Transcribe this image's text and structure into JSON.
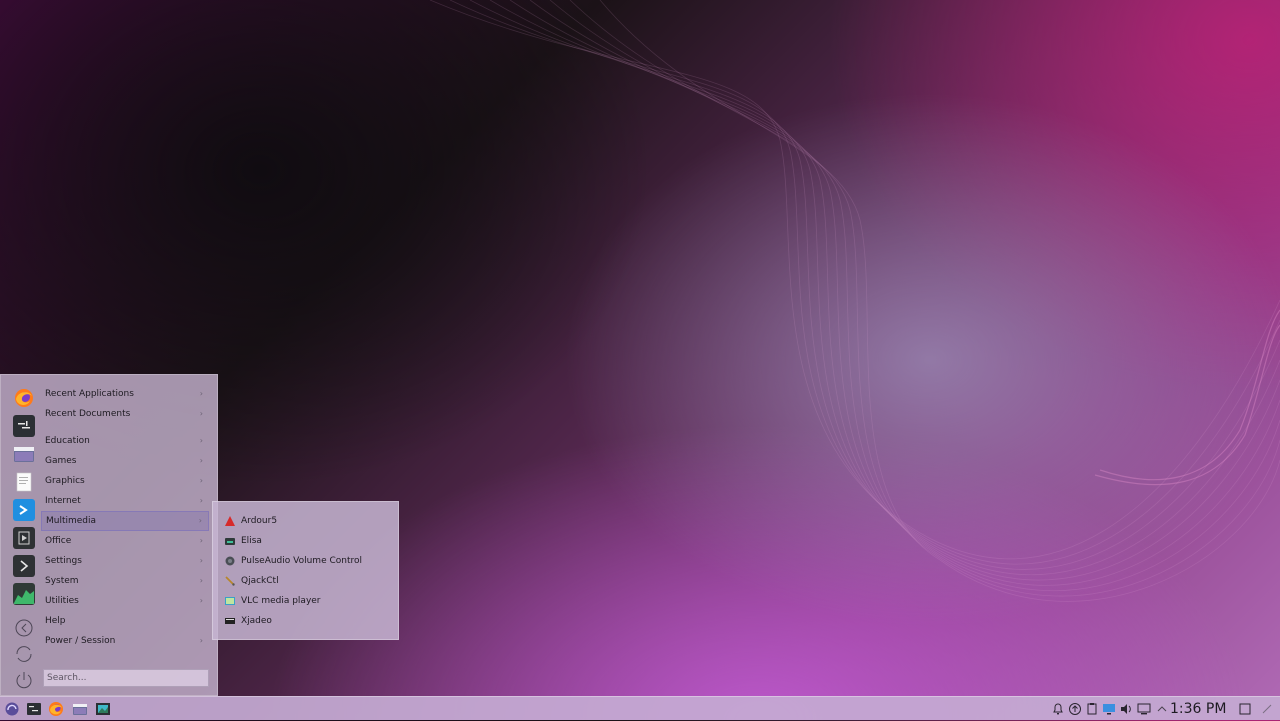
{
  "desktop": {
    "wallpaper": "plasma-purple-waves"
  },
  "start_menu": {
    "favorites": [
      "firefox-icon",
      "terminal-icon",
      "file-manager-icon",
      "text-editor-icon",
      "discover-icon",
      "media-player-icon",
      "console-icon",
      "system-monitor-icon"
    ],
    "categories": [
      {
        "label": "Recent Applications",
        "arrow": "›"
      },
      {
        "label": "Recent Documents",
        "arrow": "›"
      },
      {
        "label": "Education",
        "arrow": "›"
      },
      {
        "label": "Games",
        "arrow": "›"
      },
      {
        "label": "Graphics",
        "arrow": "›"
      },
      {
        "label": "Internet",
        "arrow": "›"
      },
      {
        "label": "Multimedia",
        "arrow": "›"
      },
      {
        "label": "Office",
        "arrow": "›"
      },
      {
        "label": "Settings",
        "arrow": "›"
      },
      {
        "label": "System",
        "arrow": "›"
      },
      {
        "label": "Utilities",
        "arrow": "›"
      },
      {
        "label": "Help",
        "arrow": ""
      },
      {
        "label": "Power / Session",
        "arrow": "›"
      }
    ],
    "active_category": "Multimedia",
    "search_placeholder": "Search...",
    "bottom_icons": [
      "back-icon",
      "switch-user-icon",
      "power-icon"
    ]
  },
  "submenu": {
    "items": [
      {
        "label": "Ardour5",
        "icon": "ardour-icon"
      },
      {
        "label": "Elisa",
        "icon": "elisa-icon"
      },
      {
        "label": "PulseAudio Volume Control",
        "icon": "pulseaudio-icon"
      },
      {
        "label": "QjackCtl",
        "icon": "qjackctl-icon"
      },
      {
        "label": "VLC media player",
        "icon": "vlc-icon"
      },
      {
        "label": "Xjadeo",
        "icon": "xjadeo-icon"
      }
    ]
  },
  "panel": {
    "launchers": [
      "app-launcher-icon",
      "terminal-icon",
      "firefox-icon",
      "file-manager-icon",
      "screenshot-icon"
    ],
    "tray_icons": [
      "notifications-icon",
      "updates-icon",
      "clipboard-icon",
      "display-icon",
      "volume-icon",
      "network-icon",
      "expand-tray-icon"
    ],
    "clock": "1:36 PM",
    "end_icons": [
      "show-desktop-icon",
      "panel-config-icon"
    ]
  },
  "colors": {
    "accent": "#8e7ac8",
    "menu_bg": "#c4b2cd",
    "panel_bg": "#c4aad2"
  }
}
